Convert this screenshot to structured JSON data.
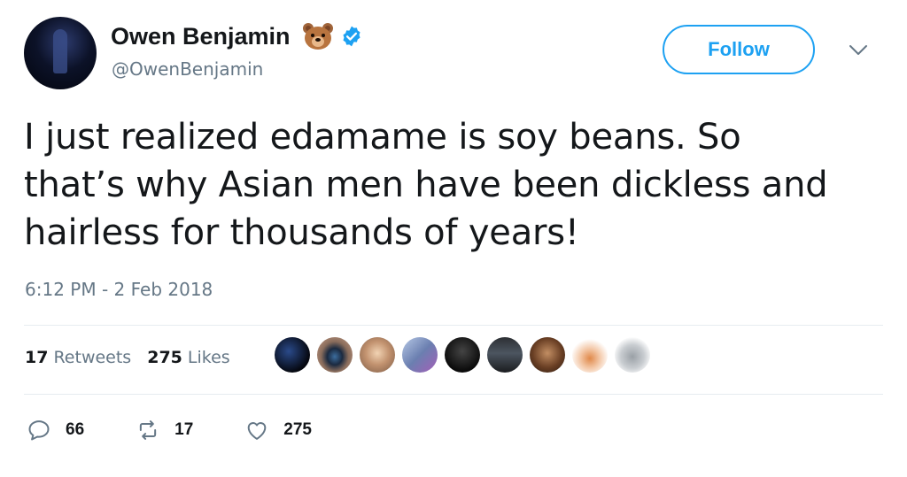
{
  "user": {
    "display_name": "Owen Benjamin",
    "handle": "@OwenBenjamin",
    "name_emoji": "bear-face-icon",
    "verified_icon": "verified-badge-icon"
  },
  "follow_button_label": "Follow",
  "tweet": {
    "text": "I just realized edamame is soy beans. So\nthat’s why Asian men have been dickless and\nhairless for thousands of years!",
    "timestamp": "6:12 PM - 2 Feb 2018"
  },
  "stats": {
    "retweets_count": "17",
    "retweets_label": "Retweets",
    "likes_count": "275",
    "likes_label": "Likes"
  },
  "actions": {
    "reply_count": "66",
    "retweet_count": "17",
    "like_count": "275"
  },
  "colors": {
    "accent": "#1da1f2",
    "secondary_text": "#657786",
    "primary_text": "#14171a"
  }
}
